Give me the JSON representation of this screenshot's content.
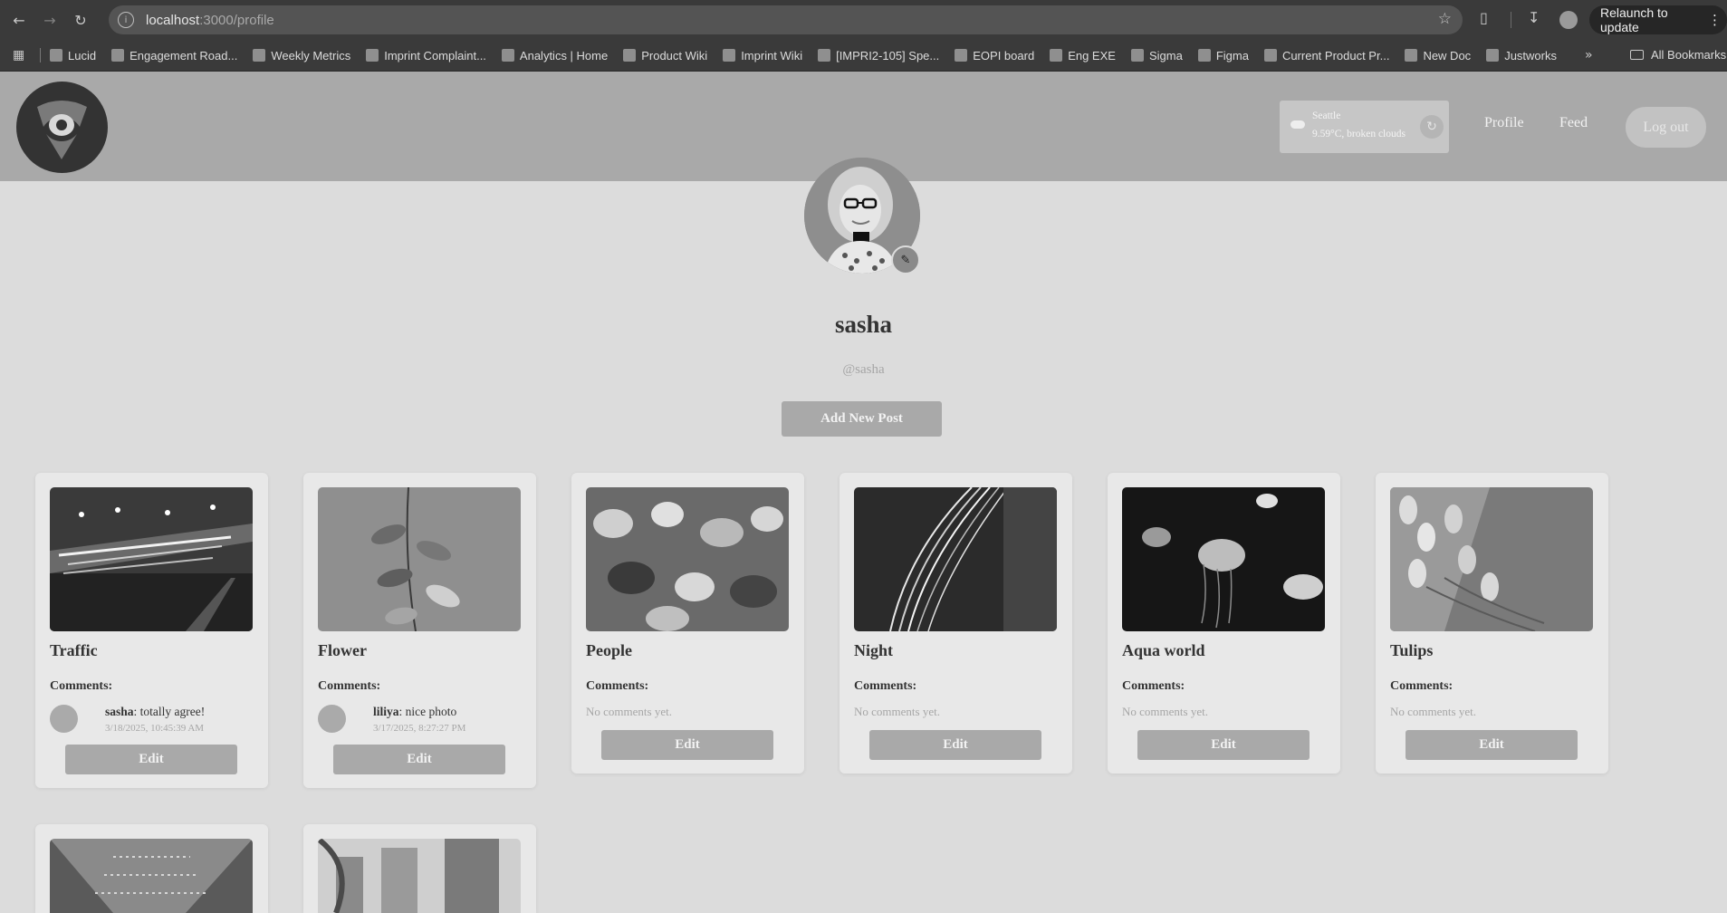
{
  "browser": {
    "url_host": "localhost",
    "url_path": ":3000/profile",
    "relaunch_label": "Relaunch to update"
  },
  "bookmarks": {
    "items": [
      {
        "label": "Lucid"
      },
      {
        "label": "Engagement Road..."
      },
      {
        "label": "Weekly Metrics"
      },
      {
        "label": "Imprint Complaint..."
      },
      {
        "label": "Analytics | Home"
      },
      {
        "label": "Product Wiki"
      },
      {
        "label": "Imprint Wiki"
      },
      {
        "label": "[IMPRI2-105] Spe..."
      },
      {
        "label": "EOPI board"
      },
      {
        "label": "Eng EXE"
      },
      {
        "label": "Sigma"
      },
      {
        "label": "Figma"
      },
      {
        "label": "Current Product Pr..."
      },
      {
        "label": "New Doc"
      },
      {
        "label": "Justworks"
      }
    ],
    "all_label": "All Bookmarks"
  },
  "header": {
    "weather": {
      "city": "Seattle",
      "description": "9.59°C, broken clouds"
    },
    "nav": {
      "profile": "Profile",
      "feed": "Feed",
      "logout": "Log out"
    }
  },
  "profile": {
    "name": "sasha",
    "handle": "@sasha",
    "add_post_label": "Add New Post"
  },
  "posts": {
    "comments_label": "Comments:",
    "no_comments": "No comments yet.",
    "edit_label": "Edit",
    "items": [
      {
        "title": "Traffic",
        "comment": {
          "user": "sasha",
          "text": ": totally agree!",
          "date": "3/18/2025, 10:45:39 AM"
        }
      },
      {
        "title": "Flower",
        "comment": {
          "user": "liliya",
          "text": ": nice photo",
          "date": "3/17/2025, 8:27:27 PM"
        }
      },
      {
        "title": "People"
      },
      {
        "title": "Night"
      },
      {
        "title": "Aqua world"
      },
      {
        "title": "Tulips"
      }
    ]
  }
}
